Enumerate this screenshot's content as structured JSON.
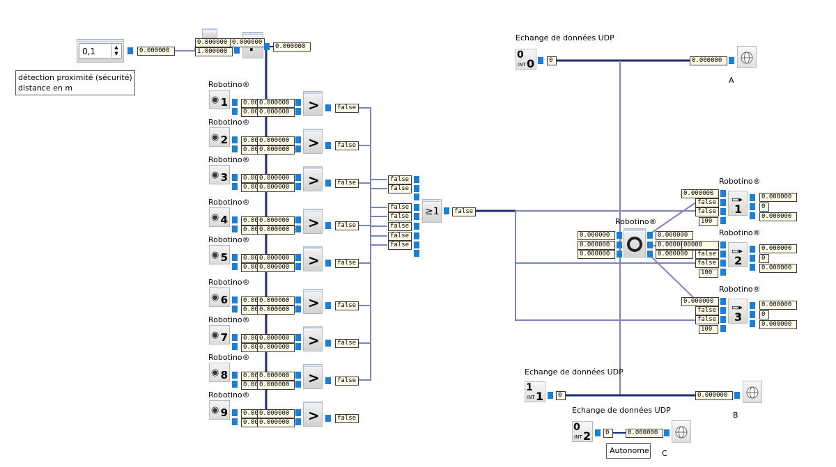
{
  "input": {
    "spin_value": "0,1",
    "out_value": "0.000000"
  },
  "multiplier": {
    "in_a": "0.000000",
    "in_b": "1.000000",
    "in_c": "0.000000",
    "out": "0.000000",
    "op": "·"
  },
  "note": {
    "line1": "détection proximité (sécurité)",
    "line2": "distance en m"
  },
  "sensors": [
    {
      "label": "Robotino®",
      "num": "1",
      "a1": "0.00",
      "a2": "0.000000",
      "b1": "0.00",
      "b2": "0.000000",
      "result": "false"
    },
    {
      "label": "Robotino®",
      "num": "2",
      "a1": "0.00",
      "a2": "0.000000",
      "b1": "0.00",
      "b2": "0.000000",
      "result": "false"
    },
    {
      "label": "Robotino®",
      "num": "3",
      "a1": "0.00",
      "a2": "0.000000",
      "b1": "0.00",
      "b2": "0.000000",
      "result": "false"
    },
    {
      "label": "Robotino®",
      "num": "4",
      "a1": "0.00",
      "a2": "0.000000",
      "b1": "0.00",
      "b2": "0.000000",
      "result": "false"
    },
    {
      "label": "Robotino®",
      "num": "5",
      "a1": "0.00",
      "a2": "0.000000",
      "b1": "0.00",
      "b2": "0.000000",
      "result": "false"
    },
    {
      "label": "Robotino®",
      "num": "6",
      "a1": "0.00",
      "a2": "0.000000",
      "b1": "0.00",
      "b2": "0.000000",
      "result": "false"
    },
    {
      "label": "Robotino®",
      "num": "7",
      "a1": "0.00",
      "a2": "0.000000",
      "b1": "0.00",
      "b2": "0.000000",
      "result": "false"
    },
    {
      "label": "Robotino®",
      "num": "8",
      "a1": "0.00",
      "a2": "0.000000",
      "b1": "0.00",
      "b2": "0.000000",
      "result": "false"
    },
    {
      "label": "Robotino®",
      "num": "9",
      "a1": "0.00",
      "a2": "0.000000",
      "b1": "0.00",
      "b2": "0.000000",
      "result": "false"
    }
  ],
  "compare_op": ">",
  "or_gate": {
    "symbol": "≥1",
    "inputs": [
      "false",
      "false",
      "false",
      "false",
      "false",
      "false",
      "false",
      "false",
      "false"
    ],
    "out": "false"
  },
  "udp_top": {
    "title": "Echange de données UDP",
    "index": "0",
    "int_label": "INT",
    "value": "0",
    "out": "0.000000",
    "label": "A"
  },
  "udp_mid": {
    "title": "Echange de données UDP",
    "index": "1",
    "int_label": "INT",
    "value": "0",
    "out": "0.000000",
    "label": "B"
  },
  "udp_bot": {
    "title": "Echange de données UDP",
    "index": "2",
    "int_label": "INT",
    "value": "0",
    "out": "0.000000",
    "label": "C",
    "button": "Autonome"
  },
  "omni": {
    "label": "Robotino®",
    "in1": "0.000000",
    "in2": "0.000000",
    "in3": "0.000000",
    "out1": "0.000000",
    "out2": "0.000000",
    "out3": "0.000000"
  },
  "motors": [
    {
      "label": "Robotino®",
      "num": "1",
      "in_val": "0.000000",
      "b1": "false",
      "b2": "false",
      "speed": "100",
      "o1": "0.000000",
      "o2": "0",
      "o3": "0.000000"
    },
    {
      "label": "Robotino®",
      "num": "2",
      "in_val": "00000",
      "b1": "false",
      "b2": "false",
      "speed": "100",
      "o1": "0.000000",
      "o2": "0",
      "o3": "0.000000"
    },
    {
      "label": "Robotino®",
      "num": "3",
      "in_val": "0.000000",
      "b1": "false",
      "b2": "false",
      "speed": "100",
      "o1": "0.000000",
      "o2": "0",
      "o3": "0.000000"
    }
  ],
  "colors": {
    "wire": "#7a84c0",
    "wire_dark": "#1c2a7a",
    "port": "#1a7fd8"
  }
}
